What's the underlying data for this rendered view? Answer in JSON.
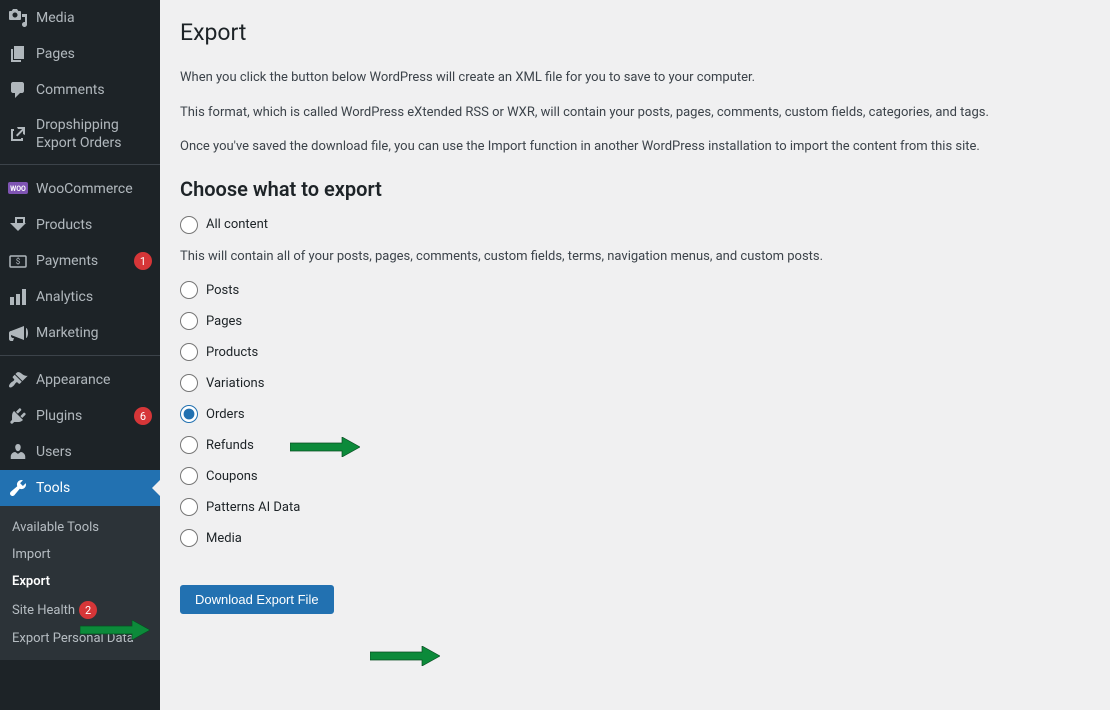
{
  "sidebar": {
    "items": [
      {
        "label": "Media"
      },
      {
        "label": "Pages"
      },
      {
        "label": "Comments"
      },
      {
        "label": "Dropshipping Export Orders"
      },
      {
        "label": "WooCommerce"
      },
      {
        "label": "Products"
      },
      {
        "label": "Payments",
        "badge": "1"
      },
      {
        "label": "Analytics"
      },
      {
        "label": "Marketing"
      },
      {
        "label": "Appearance"
      },
      {
        "label": "Plugins",
        "badge": "6"
      },
      {
        "label": "Users"
      },
      {
        "label": "Tools"
      }
    ],
    "submenu": [
      {
        "label": "Available Tools"
      },
      {
        "label": "Import"
      },
      {
        "label": "Export"
      },
      {
        "label": "Site Health",
        "badge": "2"
      },
      {
        "label": "Export Personal Data"
      }
    ]
  },
  "page": {
    "title": "Export",
    "intro1": "When you click the button below WordPress will create an XML file for you to save to your computer.",
    "intro2": "This format, which is called WordPress eXtended RSS or WXR, will contain your posts, pages, comments, custom fields, categories, and tags.",
    "intro3": "Once you've saved the download file, you can use the Import function in another WordPress installation to import the content from this site.",
    "section_heading": "Choose what to export",
    "all_content_desc": "This will contain all of your posts, pages, comments, custom fields, terms, navigation menus, and custom posts.",
    "options": {
      "all": "All content",
      "posts": "Posts",
      "pages": "Pages",
      "products": "Products",
      "variations": "Variations",
      "orders": "Orders",
      "refunds": "Refunds",
      "coupons": "Coupons",
      "patterns": "Patterns AI Data",
      "media": "Media"
    },
    "selected": "orders",
    "download_button": "Download Export File"
  }
}
